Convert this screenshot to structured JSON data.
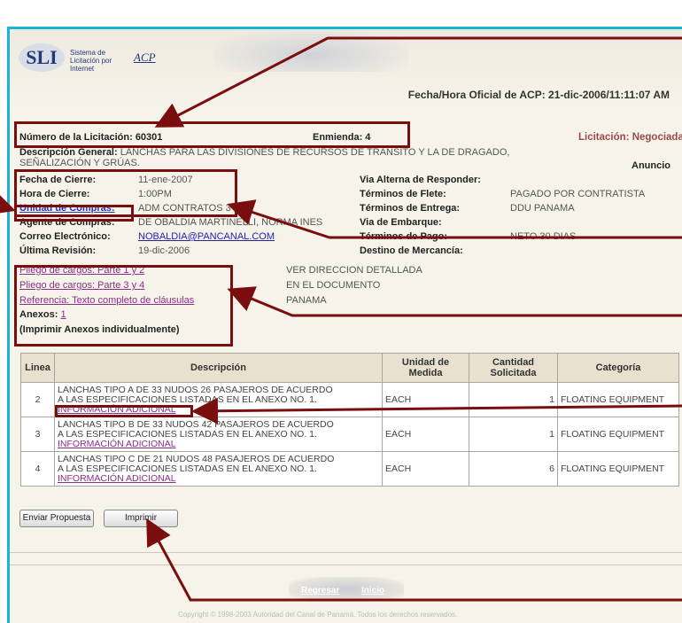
{
  "header": {
    "logo_text": "SLI",
    "logo_subtitle": "Sistema de Licitación por Internet",
    "logo_acp": "ACP",
    "official_time": "Fecha/Hora Oficial de ACP: 21-dic-2006/11:11:07 AM"
  },
  "summary": {
    "numero_label": "Número de la Licitación:",
    "numero_value": "60301",
    "enmienda_label": "Enmienda:",
    "enmienda_value": "4",
    "licitacion_status": "Licitación: Negociada",
    "descripcion_label": "Descripción General:",
    "descripcion_value": "LANCHAS PARA LAS DIVISIONES DE RECURSOS DE TRÁNSITO Y LA DE DRAGADO,",
    "descripcion_value2": "SEÑALIZACIÓN Y GRÚAS.",
    "anuncio_label": "Anuncio"
  },
  "details_left": [
    {
      "label": "Fecha de Cierre:",
      "value": "11-ene-2007"
    },
    {
      "label": "Hora de Cierre:",
      "value": "1:00PM"
    },
    {
      "label": "Unidad de Compras:",
      "value": "ADM CONTRATOS 3"
    },
    {
      "label": "Agente de Compras:",
      "value": "DE OBALDIA MARTINELLI, NORMA INES"
    },
    {
      "label": "Correo Electrónico:",
      "value": "NOBALDIA@PANCANAL.COM"
    },
    {
      "label": "Última Revisión:",
      "value": "19-dic-2006"
    }
  ],
  "details_right": [
    {
      "label": "Via Alterna de Responder:",
      "value": ""
    },
    {
      "label": "Términos de Flete:",
      "value": "PAGADO POR CONTRATISTA"
    },
    {
      "label": "Términos de Entrega:",
      "value": "DDU PANAMA"
    },
    {
      "label": "Via de Embarque:",
      "value": ""
    },
    {
      "label": "Términos de Pago:",
      "value": "NETO 30 DIAS"
    },
    {
      "label": "Destino de Mercancía:",
      "value": ""
    }
  ],
  "documents": {
    "pliego_1_2": "Pliego de cargos: Parte 1 y 2",
    "pliego_3_4": "Pliego de cargos: Parte 3 y 4",
    "referencia": "Referencia: Texto completo de cláusulas",
    "anexos_label": "Anexos:",
    "anexos_count": "1",
    "imprimir_note": "(Imprimir Anexos individualmente)"
  },
  "destination": {
    "line1": "VER DIRECCION DETALLADA",
    "line2": "EN EL DOCUMENTO",
    "line3": "PANAMA"
  },
  "table": {
    "headers": [
      "Linea",
      "Descripción",
      "Unidad de Medida",
      "Cantidad Solicitada",
      "Categoría"
    ],
    "rows": [
      {
        "linea": "2",
        "desc1": "LANCHAS TIPO A DE 33 NUDOS 26 PASAJEROS DE ACUERDO",
        "desc2": "A LAS ESPECIFICACIONES LISTADAS EN EL ANEXO NO. 1.",
        "link": "INFORMACIÓN ADICIONAL",
        "unidad": "EACH",
        "cantidad": "1",
        "categoria": "FLOATING EQUIPMENT"
      },
      {
        "linea": "3",
        "desc1": "LANCHAS TIPO B DE 33 NUDOS 42 PASAJEROS DE ACUERDO",
        "desc2": "A LAS ESPECIFICACIONES LISTADAS EN EL ANEXO NO. 1.",
        "link": "INFORMACIÓN ADICIONAL",
        "unidad": "EACH",
        "cantidad": "1",
        "categoria": "FLOATING EQUIPMENT"
      },
      {
        "linea": "4",
        "desc1": "LANCHAS TIPO C DE 21 NUDOS 48 PASAJEROS DE ACUERDO",
        "desc2": "A LAS ESPECIFICACIONES LISTADAS EN EL ANEXO NO. 1.",
        "link": "INFORMACIÓN ADICIONAL",
        "unidad": "EACH",
        "cantidad": "6",
        "categoria": "FLOATING EQUIPMENT"
      }
    ]
  },
  "buttons": {
    "enviar": "Enviar Propuesta",
    "imprimir": "Imprimir"
  },
  "footer": {
    "regresar": "Regresar",
    "inicio": "Inicio",
    "copyright": "Copyright © 1998-2003 Autoridad del Canal de Panamá. Todos los derechos reservados."
  },
  "colors": {
    "frame_border": "#18b4d8",
    "annotation": "#7a0d0d",
    "background": "#f6f3ea"
  }
}
